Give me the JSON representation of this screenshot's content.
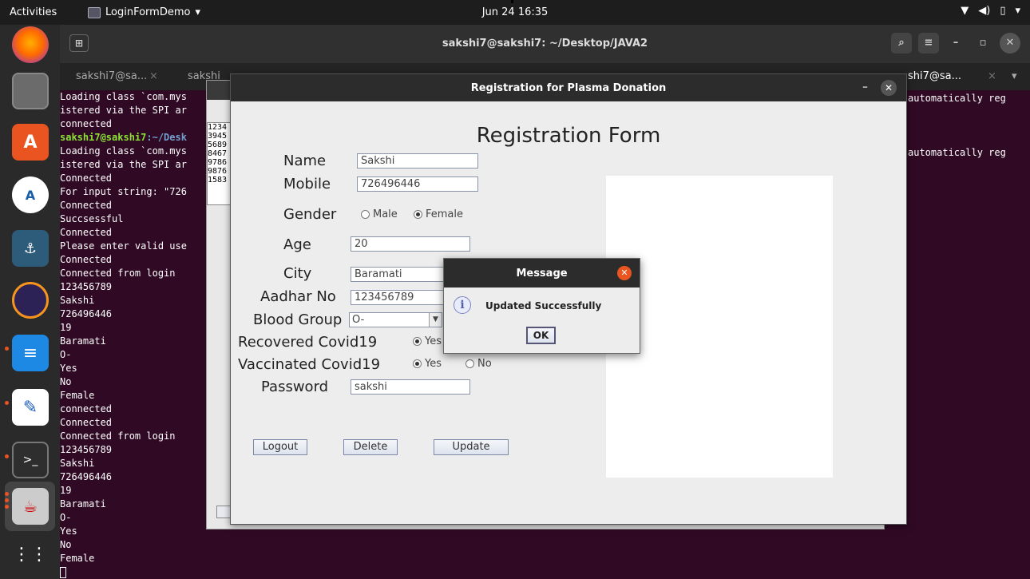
{
  "topbar": {
    "activities": "Activities",
    "app_name": "LoginFormDemo",
    "clock": "Jun 24  16:35",
    "tray": {
      "network": "▼",
      "sound": "◀)",
      "battery": "▯",
      "menu": "▾"
    }
  },
  "dock": {
    "items": [
      "firefox-icon",
      "files-icon",
      "software-icon",
      "android-studio-icon",
      "mysql-workbench-icon",
      "eclipse-icon",
      "writer-icon",
      "text-editor-icon",
      "terminal-icon",
      "java-icon",
      "app-grid-icon"
    ]
  },
  "terminal": {
    "title": "sakshi7@sakshi7: ~/Desktop/JAVA2",
    "tabs": [
      "sakshi7@sa...",
      "sakshi",
      "shi7@sa..."
    ],
    "right_text_1": "automatically reg",
    "right_text_2": "automatically reg",
    "lines": [
      "Loading class `com.mys",
      "istered via the SPI ar",
      "connected",
      "",
      "Loading class `com.mys",
      "istered via the SPI ar",
      "Connected",
      "For input string: \"726",
      "Connected",
      "Succsessful",
      "Connected",
      "Please enter valid use",
      "Connected",
      "Connected from login",
      "123456789",
      "Sakshi",
      "726496446",
      "19",
      "Baramati",
      "O-",
      "Yes",
      "No",
      "Female",
      "connected",
      "Connected",
      "Connected from login",
      "123456789",
      "Sakshi",
      "726496446",
      "19",
      "Baramati",
      "O-",
      "Yes",
      "No",
      "Female"
    ],
    "prompt_user": "sakshi7@sakshi7",
    "prompt_path": ":~/Desk"
  },
  "back_window": {
    "list": [
      "1234",
      "3945",
      "5689",
      "8467",
      "9786",
      "9876",
      "1583"
    ]
  },
  "form": {
    "window_title": "Registration for Plasma Donation",
    "heading": "Registration Form",
    "labels": {
      "name": "Name",
      "mobile": "Mobile",
      "gender": "Gender",
      "age": "Age",
      "city": "City",
      "aadhar": "Aadhar No",
      "blood_group": "Blood Group",
      "recovered": "Recovered Covid19",
      "vaccinated": "Vaccinated Covid19",
      "password": "Password"
    },
    "values": {
      "name": "Sakshi",
      "mobile": "726496446",
      "age": "20",
      "city": "Baramati",
      "aadhar": "123456789",
      "blood_group": "O-",
      "password": "sakshi"
    },
    "gender_options": {
      "male": "Male",
      "female": "Female",
      "selected": "Female"
    },
    "recovered_options": {
      "yes": "Yes",
      "selected": "Yes"
    },
    "vaccinated_options": {
      "yes": "Yes",
      "no": "No",
      "selected": "Yes"
    },
    "buttons": {
      "logout": "Logout",
      "delete": "Delete",
      "update": "Update"
    }
  },
  "dialog": {
    "title": "Message",
    "icon_glyph": "i",
    "message": "Updated Successfully",
    "ok": "OK",
    "close_color": "#e95420"
  }
}
